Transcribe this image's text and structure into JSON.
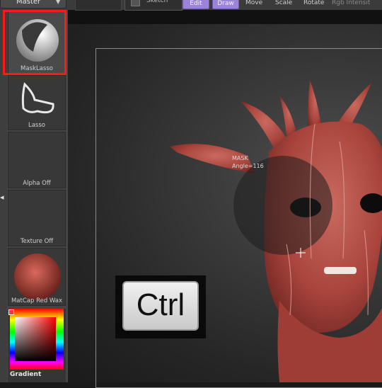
{
  "toolbar": {
    "master_label": "Master",
    "sketch_label": "Sketch",
    "edit_label": "Edit",
    "draw_label": "Draw",
    "move_label": "Move",
    "scale_label": "Scale",
    "rotate_label": "Rotate",
    "rgb_intensity_label": "Rgb Intensit"
  },
  "shelf": {
    "slots": [
      {
        "label": "MaskLasso",
        "icon": "mask-lasso-icon"
      },
      {
        "label": "Lasso",
        "icon": "lasso-icon"
      },
      {
        "label": "Alpha  Off",
        "icon": "alpha-icon"
      },
      {
        "label": "Texture  Off",
        "icon": "texture-icon"
      },
      {
        "label": "MatCap  Red  Wax",
        "icon": "matcap-icon"
      }
    ],
    "gradient_label": "Gradient"
  },
  "canvas": {
    "mask_label_line1": "MASK",
    "mask_label_line2": "Angle=116",
    "ctrl_key_label": "Ctrl"
  },
  "colors": {
    "highlight": "#ff1a1a",
    "purple_button": "#9b83d8",
    "model": "#b5463f"
  }
}
